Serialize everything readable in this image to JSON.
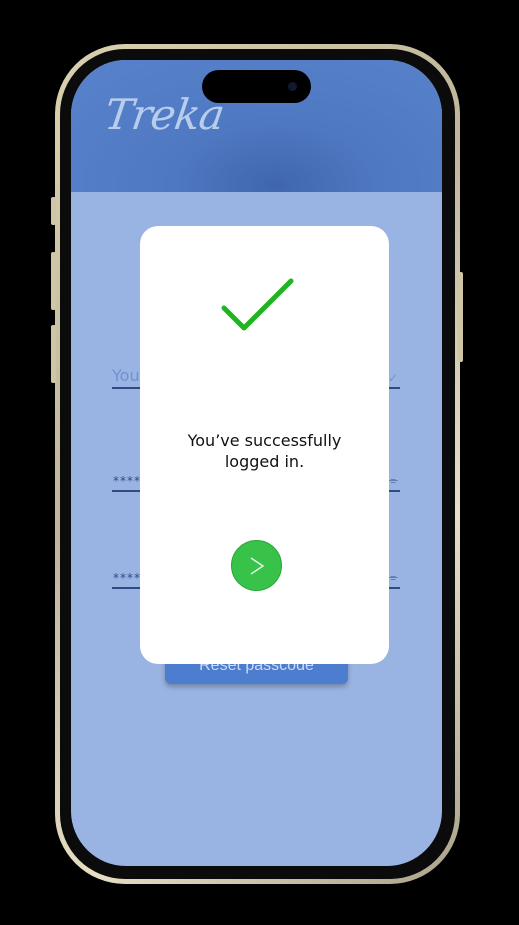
{
  "app": {
    "logo_text": "Treka"
  },
  "form": {
    "field1_placeholder": "Your email",
    "field1_trail": "✓",
    "field2_mask": "****",
    "field2_trail": "⌯",
    "field3_mask": "****",
    "field3_trail": "⌯",
    "reset_button_label": "Reset passcode"
  },
  "dialog": {
    "icon": "checkmark-icon",
    "message_line1": "You’ve successfully",
    "message_line2": "logged in.",
    "next_icon": "chevron-right-icon"
  },
  "colors": {
    "header": "#4f78c2",
    "background": "#99b4e2",
    "accent_green": "#38c24a",
    "check_green": "#1fb51f",
    "button_blue": "#4d7dcf"
  }
}
